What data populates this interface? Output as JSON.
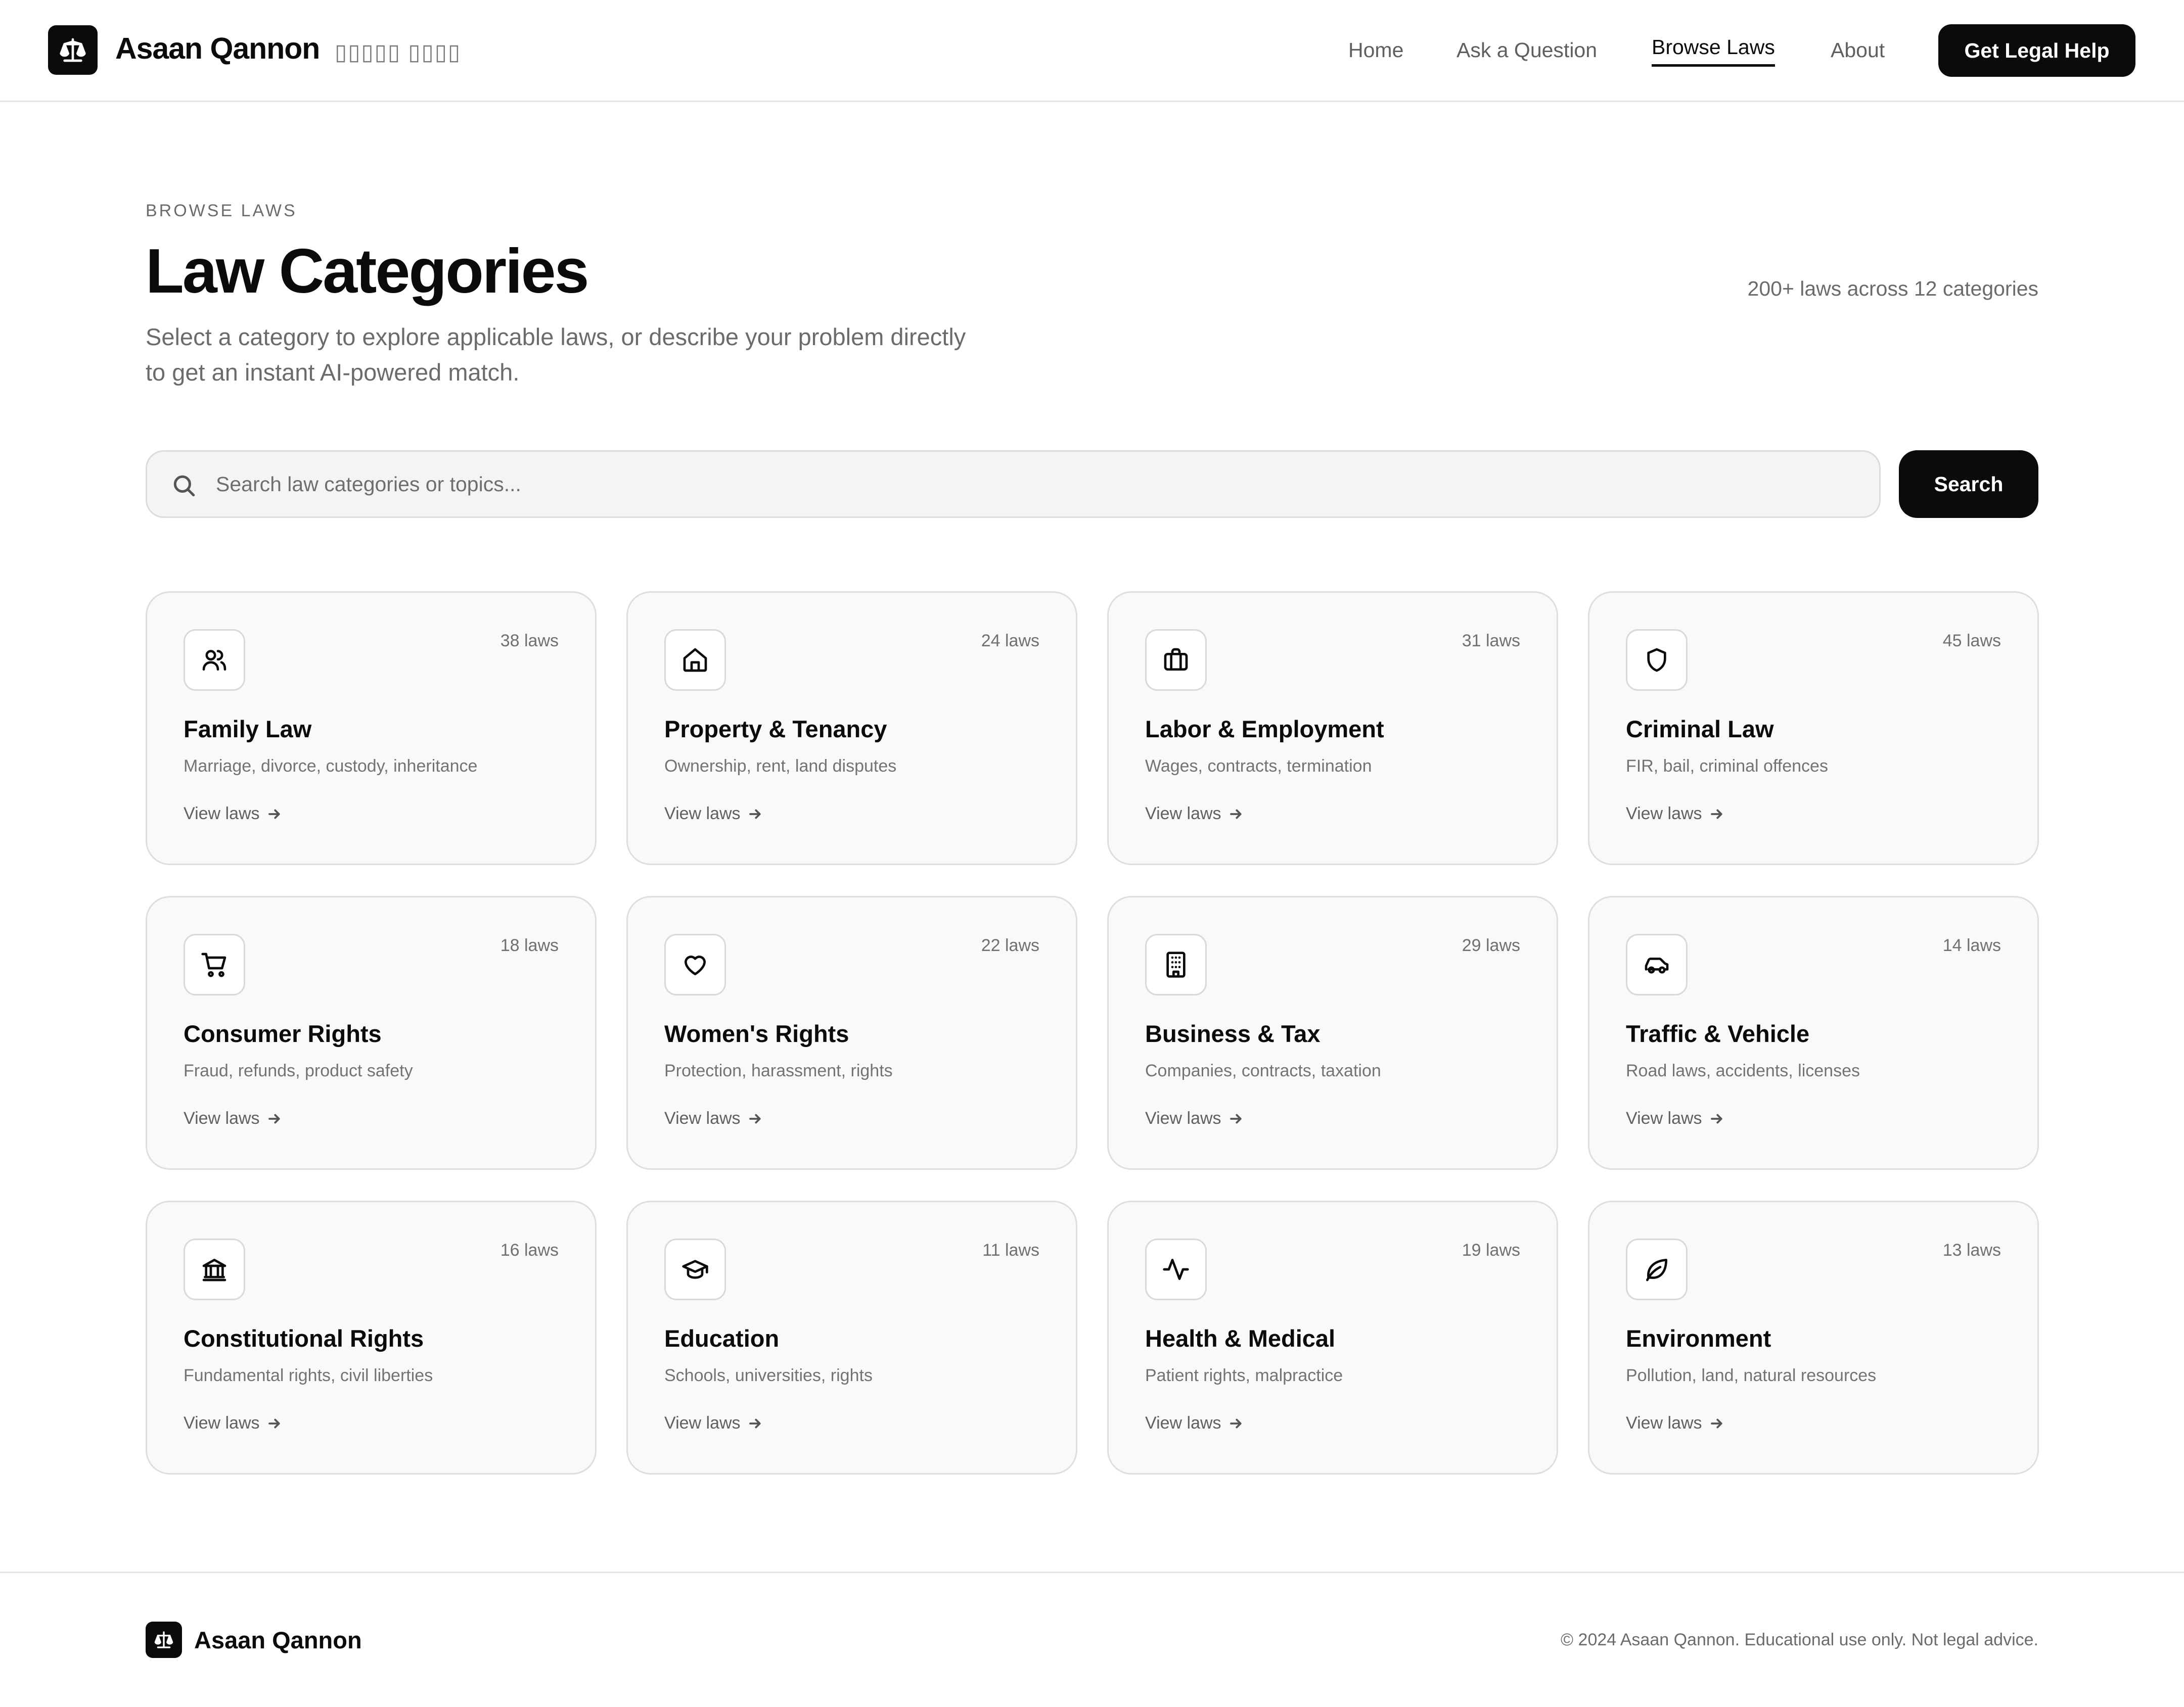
{
  "brand": {
    "name": "Asaan Qannon",
    "urdu_name": "▯▯▯▯▯ ▯▯▯▯"
  },
  "nav": {
    "items": [
      {
        "label": "Home"
      },
      {
        "label": "Ask a Question"
      },
      {
        "label": "Browse Laws"
      },
      {
        "label": "About"
      }
    ],
    "active": "Browse Laws",
    "cta_label": "Get Legal Help"
  },
  "hero": {
    "eyebrow": "BROWSE LAWS",
    "title": "Law Categories",
    "subtitle_line1": "Select a category to explore applicable laws, or describe your problem directly",
    "subtitle_line2": "to get an instant AI-powered match.",
    "stats": "200+ laws across 12 categories"
  },
  "search": {
    "placeholder": "Search law categories or topics...",
    "value": "",
    "button_label": "Search"
  },
  "link_label": "View laws",
  "categories": [
    {
      "icon": "users-icon",
      "count": "38 laws",
      "title": "Family Law",
      "desc": "Marriage, divorce, custody, inheritance"
    },
    {
      "icon": "home-icon",
      "count": "24 laws",
      "title": "Property & Tenancy",
      "desc": "Ownership, rent, land disputes"
    },
    {
      "icon": "briefcase-icon",
      "count": "31 laws",
      "title": "Labor & Employment",
      "desc": "Wages, contracts, termination"
    },
    {
      "icon": "shield-icon",
      "count": "45 laws",
      "title": "Criminal Law",
      "desc": "FIR, bail, criminal offences"
    },
    {
      "icon": "cart-icon",
      "count": "18 laws",
      "title": "Consumer Rights",
      "desc": "Fraud, refunds, product safety"
    },
    {
      "icon": "heart-icon",
      "count": "22 laws",
      "title": "Women's Rights",
      "desc": "Protection, harassment, rights"
    },
    {
      "icon": "building-icon",
      "count": "29 laws",
      "title": "Business & Tax",
      "desc": "Companies, contracts, taxation"
    },
    {
      "icon": "car-icon",
      "count": "14 laws",
      "title": "Traffic & Vehicle",
      "desc": "Road laws, accidents, licenses"
    },
    {
      "icon": "landmark-icon",
      "count": "16 laws",
      "title": "Constitutional Rights",
      "desc": "Fundamental rights, civil liberties"
    },
    {
      "icon": "graduation-cap-icon",
      "count": "11 laws",
      "title": "Education",
      "desc": "Schools, universities, rights"
    },
    {
      "icon": "activity-icon",
      "count": "19 laws",
      "title": "Health & Medical",
      "desc": "Patient rights, malpractice"
    },
    {
      "icon": "leaf-icon",
      "count": "13 laws",
      "title": "Environment",
      "desc": "Pollution, land, natural resources"
    }
  ],
  "footer": {
    "brand": "Asaan Qannon",
    "copyright": "© 2024 Asaan Qannon. Educational use only. Not legal advice."
  }
}
